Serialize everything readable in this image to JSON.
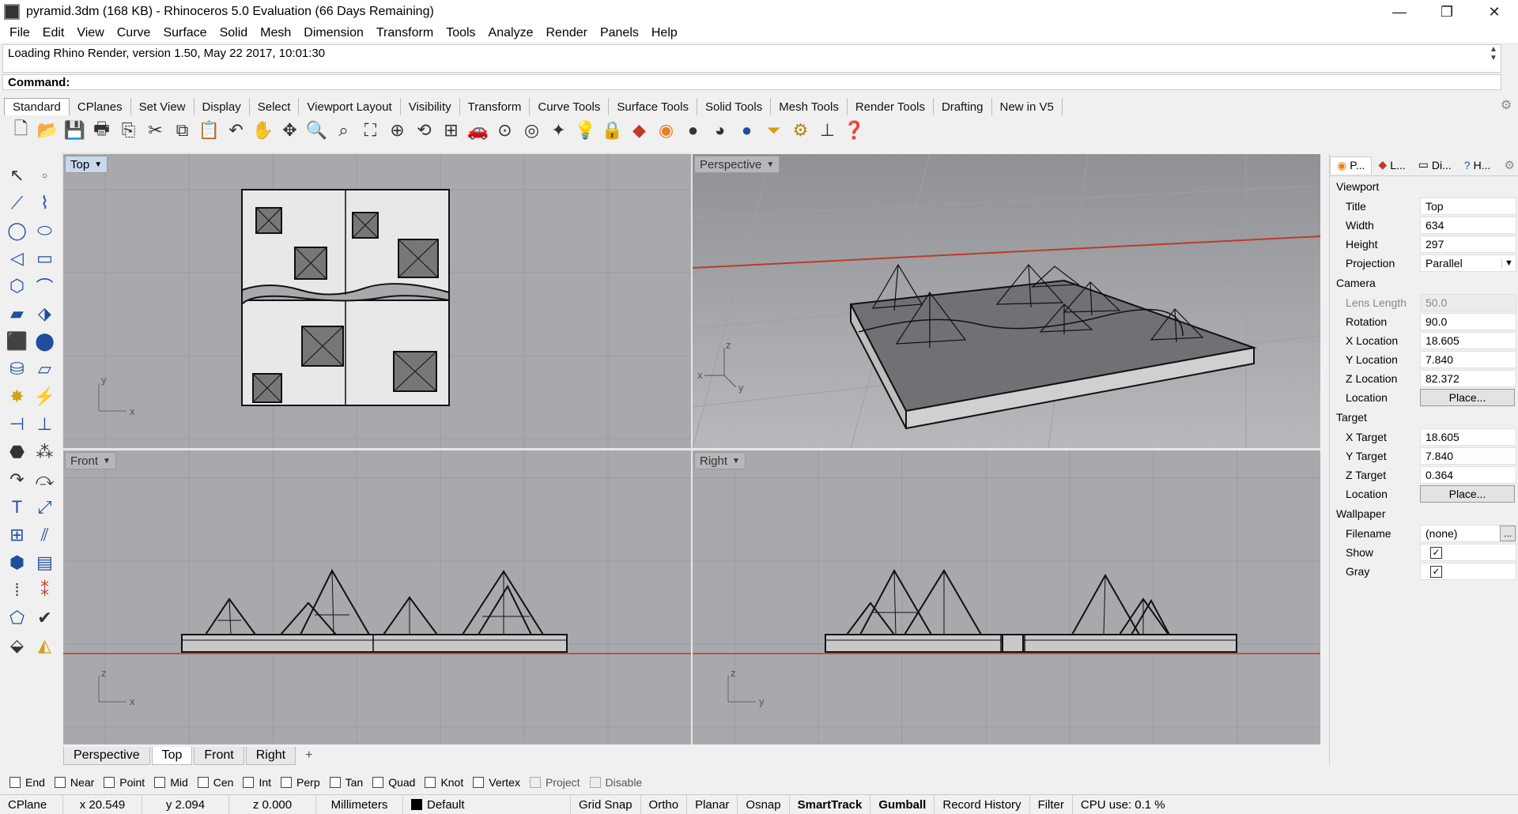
{
  "window": {
    "title": "pyramid.3dm (168 KB) - Rhinoceros 5.0 Evaluation (66 Days Remaining)",
    "minimize": "—",
    "maximize": "❐",
    "close": "✕"
  },
  "menu": [
    "File",
    "Edit",
    "View",
    "Curve",
    "Surface",
    "Solid",
    "Mesh",
    "Dimension",
    "Transform",
    "Tools",
    "Analyze",
    "Render",
    "Panels",
    "Help"
  ],
  "history": {
    "text": "Loading Rhino Render, version 1.50, May 22 2017, 10:01:30"
  },
  "command": {
    "label": "Command:",
    "value": ""
  },
  "toolbar_tabs": [
    "Standard",
    "CPlanes",
    "Set View",
    "Display",
    "Select",
    "Viewport Layout",
    "Visibility",
    "Transform",
    "Curve Tools",
    "Surface Tools",
    "Solid Tools",
    "Mesh Tools",
    "Render Tools",
    "Drafting",
    "New in V5"
  ],
  "toolbar_icons": [
    "new-file-icon",
    "open-icon",
    "save-icon",
    "print-icon",
    "import-icon",
    "cut-icon",
    "copy-icon",
    "paste-icon",
    "undo-icon",
    "pan-icon",
    "rotate-view-icon",
    "zoom-icon",
    "zoom-window-icon",
    "zoom-extents-icon",
    "zoom-selected-icon",
    "undo-view-icon",
    "four-viewports-icon",
    "car-icon",
    "orbit-icon",
    "cplane-icon",
    "osnap-icon",
    "light-icon",
    "lock-icon",
    "layer-icon",
    "color-wheel-icon",
    "shade-icon",
    "render-preview-icon",
    "render-icon",
    "filter-icon",
    "options-icon",
    "dimension-icon",
    "help-icon"
  ],
  "sidebar_icons": [
    "select-icon",
    "point-icon",
    "polyline-icon",
    "curve-icon",
    "circle-icon",
    "ellipse-icon",
    "arc-icon",
    "rectangle-icon",
    "polygon-icon",
    "fillet-icon",
    "surface-icon",
    "surface-edit-icon",
    "box-icon",
    "boolean-icon",
    "cylinder-icon",
    "plane-icon",
    "explode-icon",
    "trim-icon",
    "move-icon",
    "scale-icon",
    "solid-icon",
    "cluster-icon",
    "curve-tool-icon",
    "offset-icon",
    "text-icon",
    "dim-icon",
    "group-icon",
    "align-icon",
    "block-icon",
    "hatch-icon",
    "array-icon",
    "history-icon",
    "layout-icon",
    "check-icon",
    "shading-icon",
    "paint-icon"
  ],
  "viewports": {
    "top": {
      "title": "Top"
    },
    "perspective": {
      "title": "Perspective"
    },
    "front": {
      "title": "Front"
    },
    "right": {
      "title": "Right"
    }
  },
  "viewport_tabs": [
    "Perspective",
    "Top",
    "Front",
    "Right"
  ],
  "viewport_tab_add": "+",
  "panel": {
    "tabs": [
      "P...",
      "L...",
      "Di...",
      "H..."
    ],
    "viewport": {
      "heading": "Viewport",
      "title_label": "Title",
      "title": "Top",
      "width_label": "Width",
      "width": "634",
      "height_label": "Height",
      "height": "297",
      "projection_label": "Projection",
      "projection": "Parallel"
    },
    "camera": {
      "heading": "Camera",
      "lens_label": "Lens Length",
      "lens": "50.0",
      "rotation_label": "Rotation",
      "rotation": "90.0",
      "x_label": "X Location",
      "x": "18.605",
      "y_label": "Y Location",
      "y": "7.840",
      "z_label": "Z Location",
      "z": "82.372",
      "location_label": "Location",
      "place": "Place..."
    },
    "target": {
      "heading": "Target",
      "x_label": "X Target",
      "x": "18.605",
      "y_label": "Y Target",
      "y": "7.840",
      "z_label": "Z Target",
      "z": "0.364",
      "location_label": "Location",
      "place": "Place..."
    },
    "wallpaper": {
      "heading": "Wallpaper",
      "filename_label": "Filename",
      "filename": "(none)",
      "dots": "...",
      "show_label": "Show",
      "show": true,
      "gray_label": "Gray",
      "gray": true
    }
  },
  "osnaps": [
    {
      "label": "End",
      "checked": false
    },
    {
      "label": "Near",
      "checked": false
    },
    {
      "label": "Point",
      "checked": false
    },
    {
      "label": "Mid",
      "checked": false
    },
    {
      "label": "Cen",
      "checked": false
    },
    {
      "label": "Int",
      "checked": false
    },
    {
      "label": "Perp",
      "checked": false
    },
    {
      "label": "Tan",
      "checked": false
    },
    {
      "label": "Quad",
      "checked": false
    },
    {
      "label": "Knot",
      "checked": false
    },
    {
      "label": "Vertex",
      "checked": false
    },
    {
      "label": "Project",
      "checked": false,
      "disabled": true
    },
    {
      "label": "Disable",
      "checked": false,
      "disabled": true
    }
  ],
  "status": {
    "cplane": "CPlane",
    "x": "x 20.549",
    "y": "y 2.094",
    "z": "z 0.000",
    "units": "Millimeters",
    "layer": "Default",
    "grid_snap": "Grid Snap",
    "ortho": "Ortho",
    "planar": "Planar",
    "osnap": "Osnap",
    "smarttrack": "SmartTrack",
    "gumball": "Gumball",
    "record_history": "Record History",
    "filter": "Filter",
    "cpu": "CPU use: 0.1 %"
  },
  "axis_labels": {
    "x": "x",
    "y": "y",
    "z": "z"
  },
  "colors": {
    "viewport_bg": "#a7a9ac",
    "grid": "#9a9ca0",
    "axis_red": "#c0392b",
    "active_title": "#c9d8ec"
  }
}
